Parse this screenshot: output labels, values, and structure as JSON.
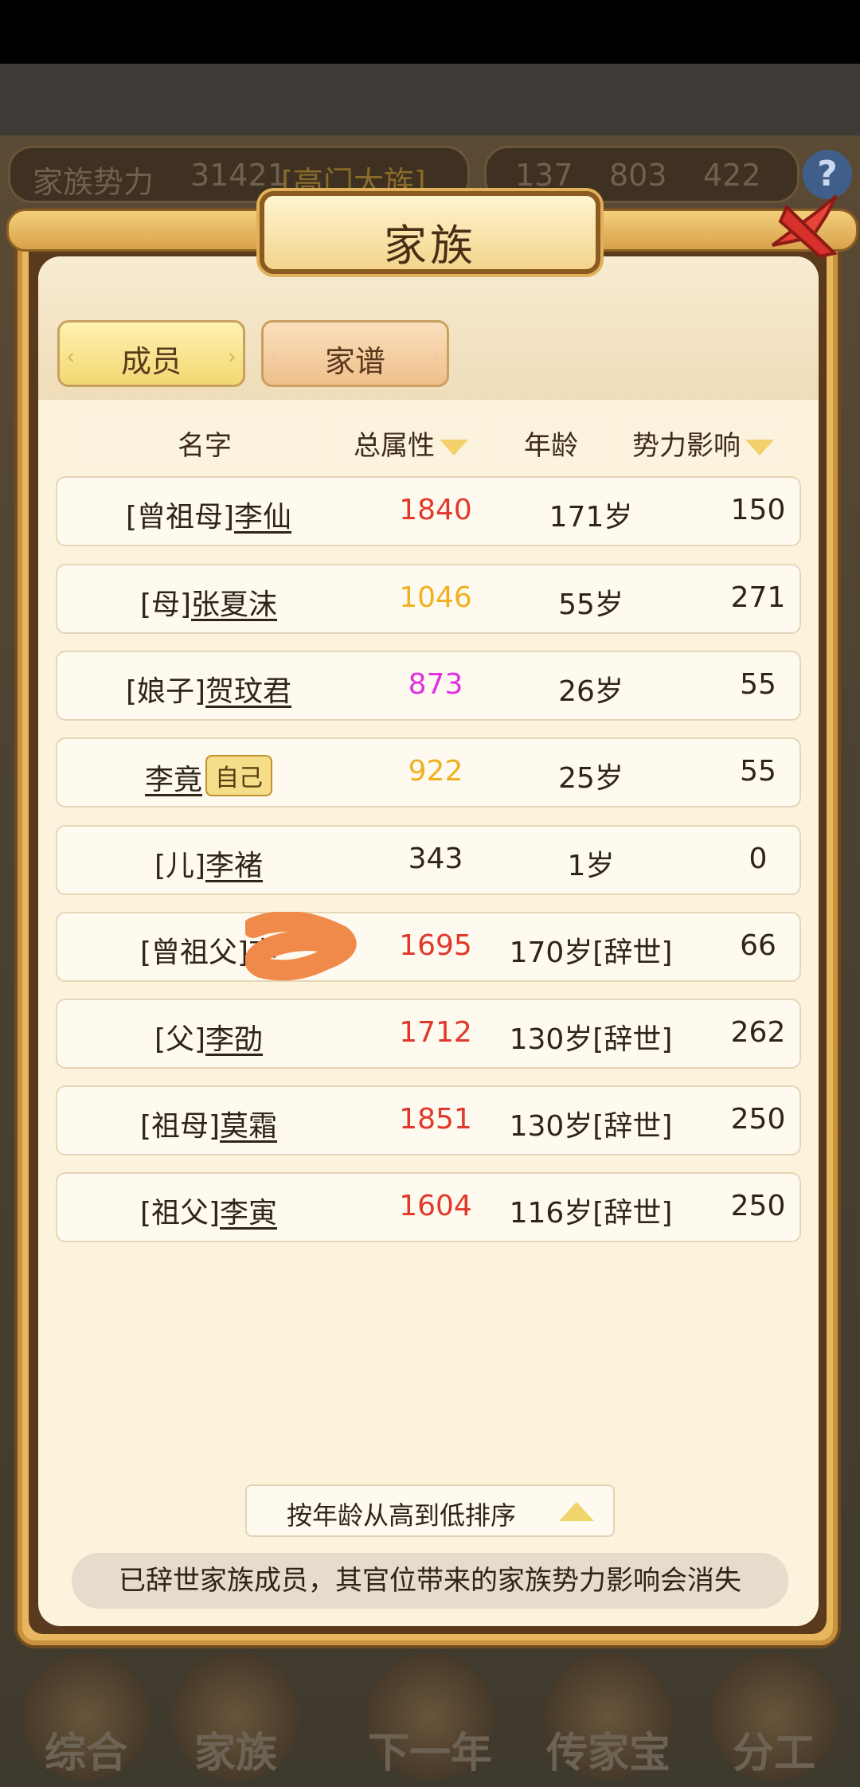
{
  "resources": {
    "power_label": "家族势力",
    "power_value": "31421",
    "power_rank": "[高门大族]",
    "res1": "137",
    "res2": "803",
    "res3": "422"
  },
  "dialog": {
    "title": "家族",
    "tabs": [
      {
        "label": "成员",
        "active": true
      },
      {
        "label": "家谱",
        "active": false
      }
    ],
    "headers": {
      "name": "名字",
      "total": "总属性",
      "age": "年龄",
      "influence": "势力影响"
    },
    "members": [
      {
        "relation": "[曾祖母]",
        "name": "李仙",
        "total": "1840",
        "total_color": "#e0392b",
        "age": "171岁",
        "influence": "150"
      },
      {
        "relation": "[母]",
        "name": "张夏沫",
        "total": "1046",
        "total_color": "#f0b020",
        "age": "55岁",
        "influence": "271"
      },
      {
        "relation": "[娘子]",
        "name": "贺玟君",
        "total": "873",
        "total_color": "#e030e0",
        "age": "26岁",
        "influence": "55"
      },
      {
        "relation": "",
        "name": "李竟",
        "badge": "自己",
        "total": "922",
        "total_color": "#f0b020",
        "age": "25岁",
        "influence": "55"
      },
      {
        "relation": "[儿]",
        "name": "李褚",
        "total": "343",
        "total_color": "#2e2418",
        "age": "1岁",
        "influence": "0"
      },
      {
        "relation": "[曾祖父]",
        "name": "李",
        "total": "1695",
        "total_color": "#e0392b",
        "age": "170岁[辞世]",
        "influence": "66"
      },
      {
        "relation": "[父]",
        "name": "李劭",
        "total": "1712",
        "total_color": "#e0392b",
        "age": "130岁[辞世]",
        "influence": "262"
      },
      {
        "relation": "[祖母]",
        "name": "莫霜",
        "total": "1851",
        "total_color": "#e0392b",
        "age": "130岁[辞世]",
        "influence": "250"
      },
      {
        "relation": "[祖父]",
        "name": "李寅",
        "total": "1604",
        "total_color": "#e0392b",
        "age": "116岁[辞世]",
        "influence": "250"
      }
    ],
    "sort_label": "按年龄从高到低排序",
    "note": "已辞世家族成员，其官位带来的家族势力影响会消失"
  },
  "bottom_nav": [
    "综合",
    "家族",
    "下一年",
    "传家宝",
    "分工"
  ],
  "colors": {
    "accent_gold": "#e7b65d",
    "red_value": "#e0392b",
    "gold_value": "#f0b020",
    "magenta_value": "#e030e0"
  }
}
